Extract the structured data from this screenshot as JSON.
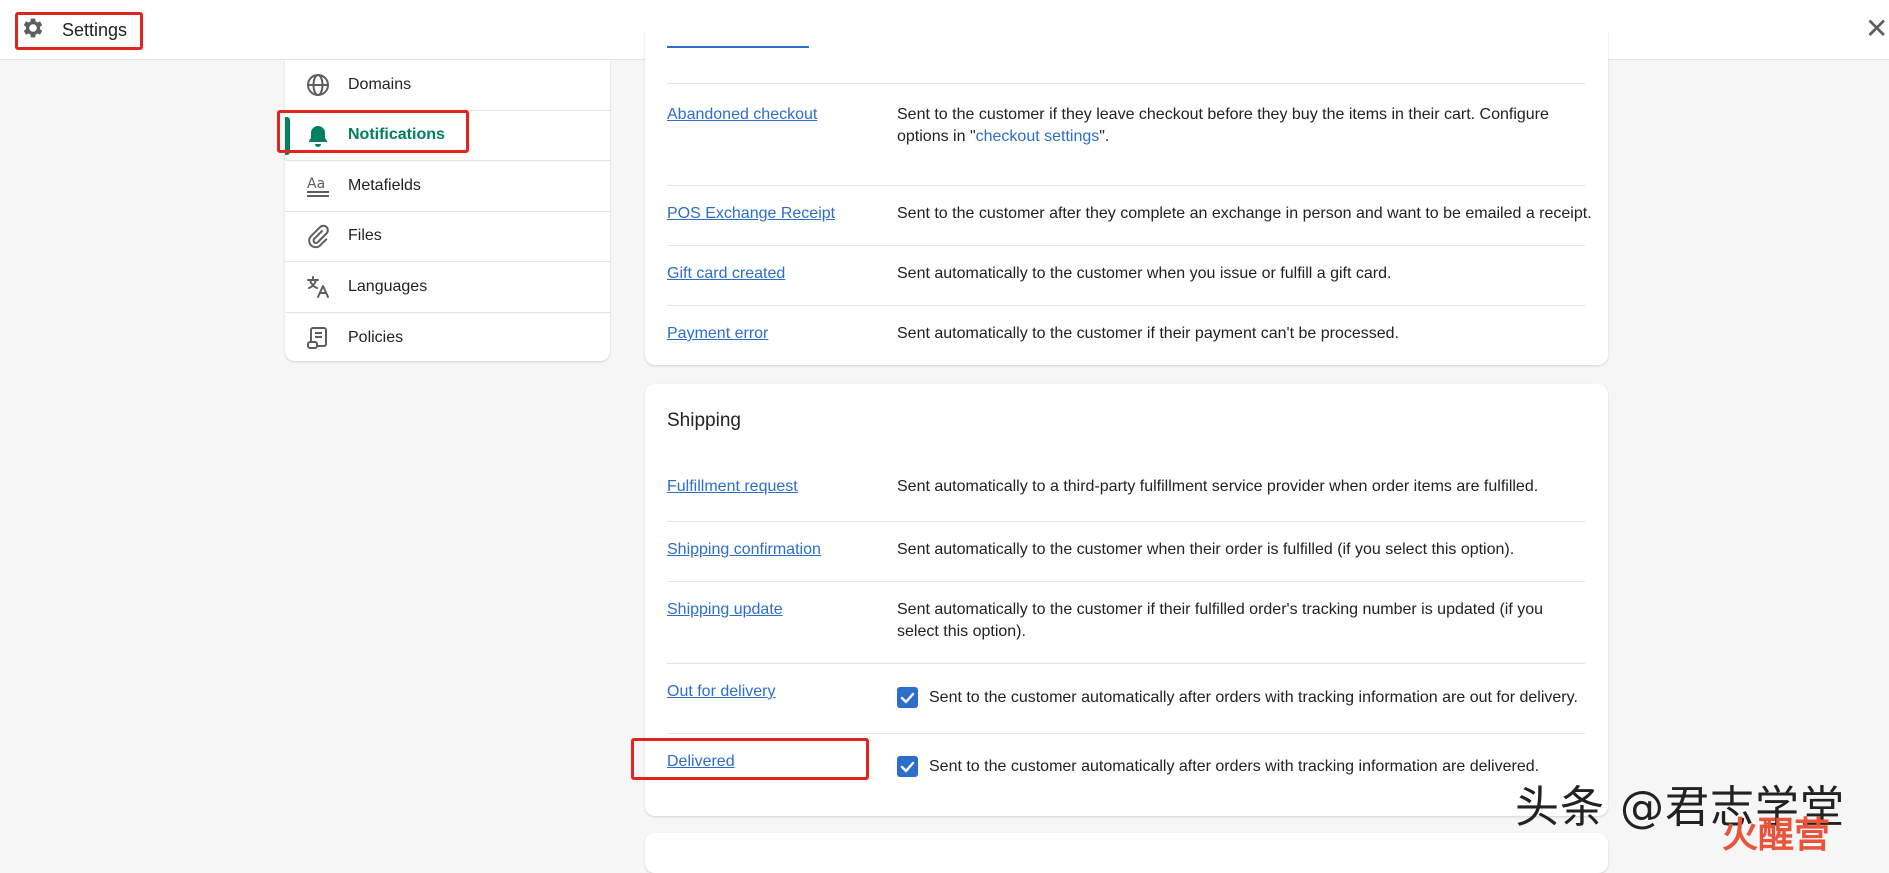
{
  "header": {
    "title": "Settings",
    "close_glyph": "✕"
  },
  "sidebar": {
    "items": [
      {
        "label": "Domains",
        "icon": "globe-icon"
      },
      {
        "label": "Notifications",
        "icon": "bell-icon",
        "active": true
      },
      {
        "label": "Metafields",
        "icon": "metafields-icon"
      },
      {
        "label": "Files",
        "icon": "paperclip-icon"
      },
      {
        "label": "Languages",
        "icon": "translate-icon"
      },
      {
        "label": "Policies",
        "icon": "policy-scroll-icon"
      }
    ]
  },
  "customer_notifications": {
    "rows": [
      {
        "name": "Abandoned checkout",
        "desc_pre": "Sent to the customer if they leave checkout before they buy the items in their cart. Configure options in \"",
        "desc_link": "checkout settings",
        "desc_post": "\"."
      },
      {
        "name": "POS Exchange Receipt",
        "desc": "Sent to the customer after they complete an exchange in person and want to be emailed a receipt."
      },
      {
        "name": "Gift card created",
        "desc": "Sent automatically to the customer when you issue or fulfill a gift card."
      },
      {
        "name": "Payment error",
        "desc": "Sent automatically to the customer if their payment can't be processed."
      }
    ]
  },
  "shipping": {
    "title": "Shipping",
    "rows": [
      {
        "name": "Fulfillment request",
        "desc": "Sent automatically to a third-party fulfillment service provider when order items are fulfilled."
      },
      {
        "name": "Shipping confirmation",
        "desc": "Sent automatically to the customer when their order is fulfilled (if you select this option)."
      },
      {
        "name": "Shipping update",
        "desc": "Sent automatically to the customer if their fulfilled order's tracking number is updated (if you select this option)."
      },
      {
        "name": "Out for delivery",
        "desc": "Sent to the customer automatically after orders with tracking information are out for delivery.",
        "checked": true
      },
      {
        "name": "Delivered",
        "desc": "Sent to the customer automatically after orders with tracking information are delivered.",
        "checked": true
      }
    ]
  },
  "watermark": {
    "text": "头条 @君志学堂",
    "sub": "火醒营"
  },
  "colors": {
    "accent_green": "#008060",
    "link_blue": "#2c6ecb",
    "annotation_red": "#e0251f"
  }
}
